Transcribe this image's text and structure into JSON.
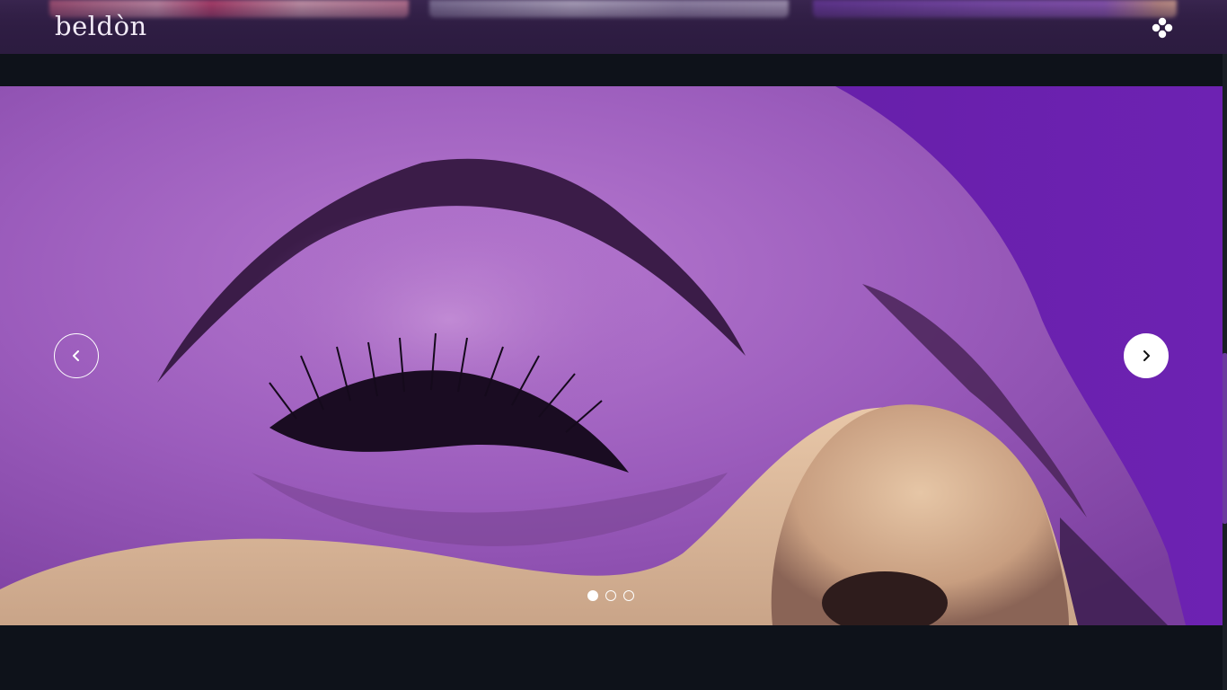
{
  "header": {
    "logo_text": "beldòn",
    "menu_icon": "menu-dots-icon"
  },
  "hero": {
    "prev_icon": "chevron-left-icon",
    "next_icon": "chevron-right-icon",
    "slides": [
      {
        "active": true
      },
      {
        "active": false
      },
      {
        "active": false
      }
    ]
  },
  "colors": {
    "header_bg": "#2c1c40",
    "page_bg": "#0e121a",
    "hero_accent": "#6a1fae",
    "white": "#ffffff"
  }
}
